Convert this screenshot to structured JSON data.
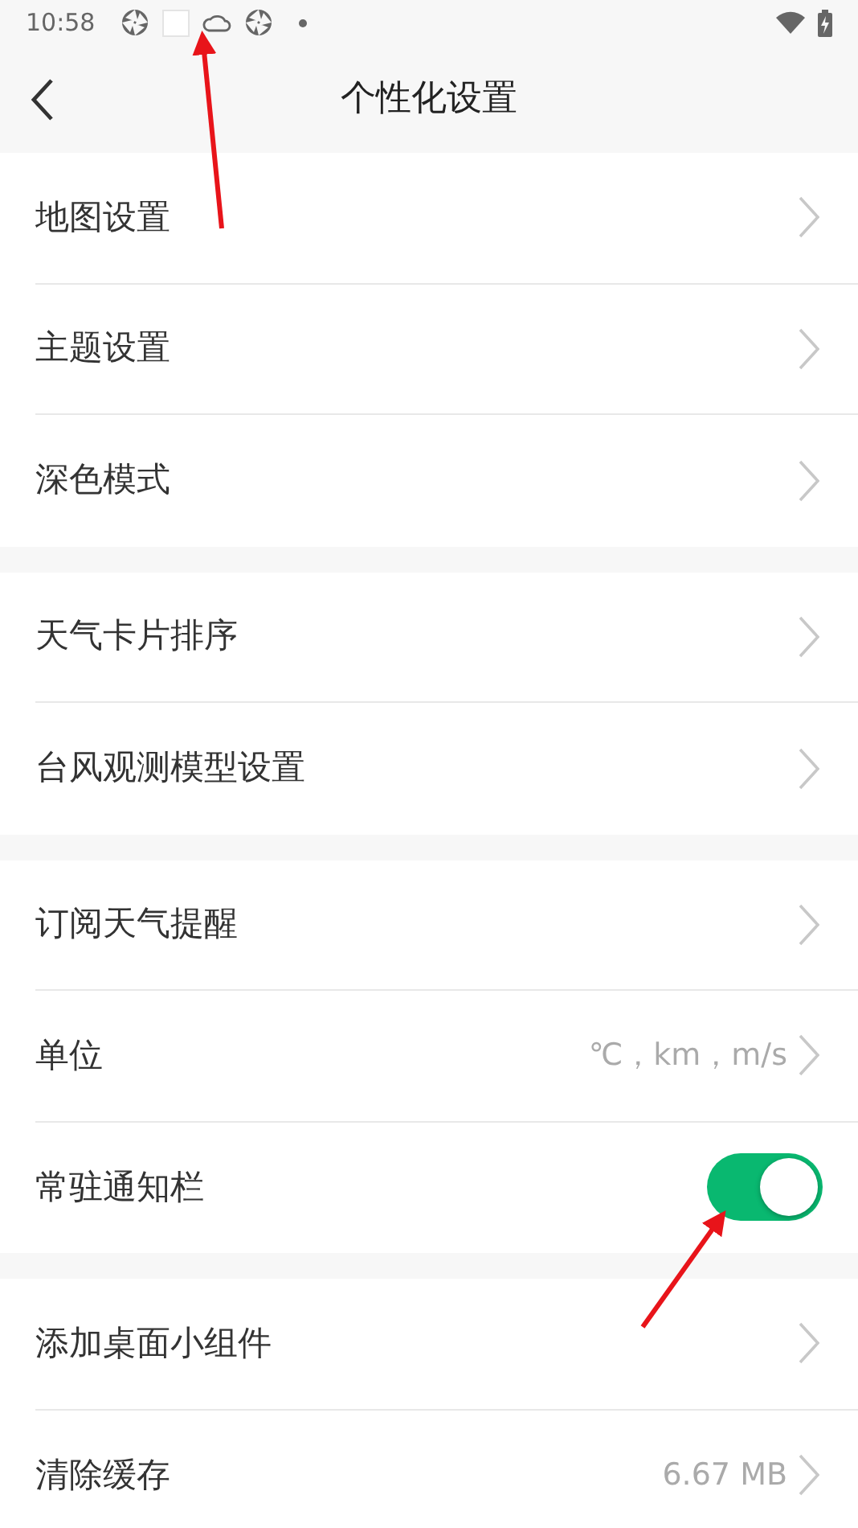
{
  "status_bar": {
    "time": "10:58"
  },
  "header": {
    "title": "个性化设置"
  },
  "groups": [
    {
      "items": [
        {
          "kind": "link",
          "label": "地图设置"
        },
        {
          "kind": "link",
          "label": "主题设置"
        },
        {
          "kind": "link",
          "label": "深色模式"
        }
      ]
    },
    {
      "items": [
        {
          "kind": "link",
          "label": "天气卡片排序"
        },
        {
          "kind": "link",
          "label": "台风观测模型设置"
        }
      ]
    },
    {
      "items": [
        {
          "kind": "link",
          "label": "订阅天气提醒"
        },
        {
          "kind": "link",
          "label": "单位",
          "value": "℃，km，m/s"
        },
        {
          "kind": "toggle",
          "label": "常驻通知栏",
          "on": true
        }
      ]
    },
    {
      "items": [
        {
          "kind": "link",
          "label": "添加桌面小组件"
        },
        {
          "kind": "link",
          "label": "清除缓存",
          "value": "6.67 MB"
        }
      ]
    }
  ],
  "annotations": [
    {
      "kind": "arrow"
    },
    {
      "kind": "arrow"
    }
  ]
}
